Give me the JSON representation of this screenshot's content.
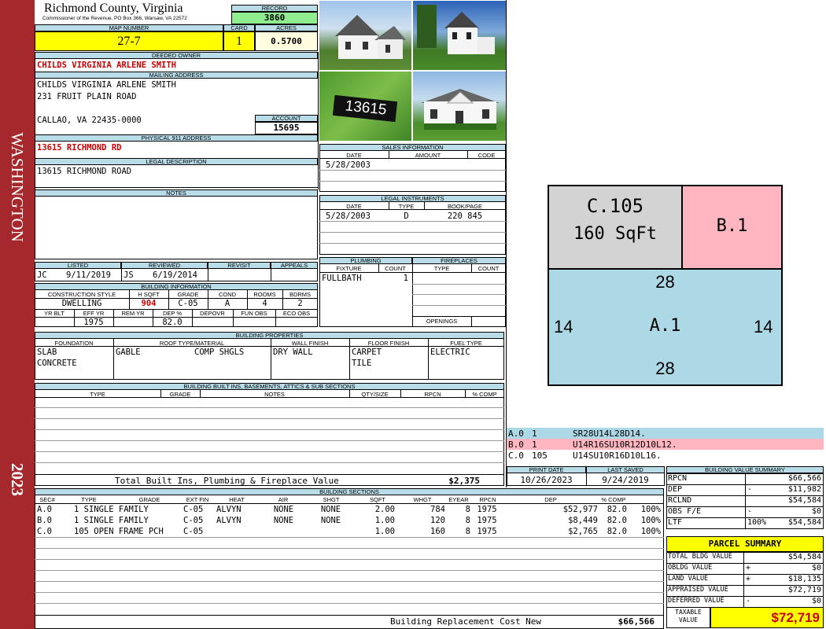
{
  "spine": {
    "district": "WASHINGTON",
    "year": "2023"
  },
  "header": {
    "county": "Richmond County, Virginia",
    "commissioner": "Commissioner of the Revenue, PO Box 366, Warsaw, VA 22572"
  },
  "record": {
    "label": "RECORD",
    "value": "3860"
  },
  "map": {
    "label": "MAP NUMBER",
    "value": "27-7"
  },
  "card": {
    "label": "CARD",
    "value": "1"
  },
  "acres": {
    "label": "ACRES",
    "value": "0.5700"
  },
  "owner": {
    "label": "DEEDED OWNER",
    "value": "CHILDS VIRGINIA ARLENE SMITH"
  },
  "mailing": {
    "label": "MAILING ADDRESS",
    "line1": "CHILDS VIRGINIA ARLENE SMITH",
    "line2": "231 FRUIT PLAIN ROAD",
    "line3": "CALLAO, VA 22435-0000"
  },
  "account": {
    "label": "ACCOUNT",
    "value": "15695"
  },
  "physical": {
    "label": "PHYSICAL 911 ADDRESS",
    "value": "13615 RICHMOND RD"
  },
  "legal": {
    "label": "LEGAL DESCRIPTION",
    "value": "13615 RICHMOND ROAD"
  },
  "notes": {
    "label": "NOTES"
  },
  "photos": {
    "sign_text": "13615"
  },
  "sales": {
    "label": "SALES INFORMATION",
    "cols": [
      "DATE",
      "AMOUNT",
      "CODE"
    ],
    "rows": [
      [
        "5/28/2003",
        "",
        ""
      ]
    ]
  },
  "legal_inst": {
    "label": "LEGAL INSTRUMENTS",
    "cols": [
      "DATE",
      "TYPE",
      "BOOK/PAGE"
    ],
    "rows": [
      [
        "5/28/2003",
        "D",
        "220 845"
      ]
    ]
  },
  "listed": {
    "listed_label": "LISTED",
    "reviewed_label": "REVIEWED",
    "revisit_label": "REVISIT",
    "appeals_label": "APPEALS",
    "listed_by": "JC",
    "listed_date": "9/11/2019",
    "reviewed_by": "JS",
    "reviewed_date": "6/19/2014"
  },
  "plumbing": {
    "label": "PLUMBING",
    "fixture": "FIXTURE",
    "count": "COUNT",
    "row_fixture": "FULLBATH",
    "row_count": "1"
  },
  "fireplaces": {
    "label": "FIREPLACES",
    "type": "TYPE",
    "count": "COUNT",
    "openings": "OPENINGS"
  },
  "bldg_info": {
    "label": "BUILDING INFORMATION",
    "cols": [
      "CONSTRUCTION STYLE",
      "H SQFT",
      "GRADE",
      "COND",
      "ROOMS",
      "BDRMS"
    ],
    "vals": [
      "DWELLING",
      "904",
      "C-05",
      "A",
      "4",
      "2"
    ],
    "cols2": [
      "YR BLT",
      "EFF YR",
      "REM YR",
      "DEP %",
      "DEPOVR",
      "FUN OBS",
      "ECO OBS"
    ],
    "vals2": [
      "",
      "1975",
      "",
      "82.0",
      "",
      "",
      ""
    ]
  },
  "props": {
    "label": "BUILDING PROPERTIES",
    "cols": [
      "FOUNDATION",
      "ROOF TYPE/MATERIAL",
      "WALL FINISH",
      "FLOOR FINISH",
      "FUEL TYPE"
    ],
    "foundation1": "SLAB",
    "foundation2": "CONCRETE",
    "roof_type": "GABLE",
    "roof_mat": "COMP SHGLS",
    "wall": "DRY WALL",
    "floor1": "CARPET",
    "floor2": "TILE",
    "fuel": "ELECTRIC"
  },
  "builtins": {
    "label": "BUILDING BUILT INS, BASEMENTS, ATTICS & SUB SECTIONS",
    "cols": [
      "TYPE",
      "GRADE",
      "NOTES",
      "QTY/SIZE",
      "RPCN",
      "% COMP"
    ],
    "total_label": "Total Built Ins, Plumbing & Fireplace Value",
    "total_value": "$2,375"
  },
  "sections": {
    "label": "BUILDING SECTIONS",
    "cols": [
      "SEC#",
      "TYPE",
      "GRADE",
      "EXT FIN",
      "HEAT",
      "AIR",
      "SHGT",
      "SQFT",
      "WHGT",
      "EYEAR",
      "RPCN",
      "DEP",
      "% COMP"
    ],
    "rows": [
      [
        "A.0",
        "1 SINGLE FAMILY",
        "C-05",
        "ALVYN",
        "NONE",
        "NONE",
        "2.00",
        "784",
        "8",
        "1975",
        "$52,977",
        "82.0",
        "100%"
      ],
      [
        "B.0",
        "1 SINGLE FAMILY",
        "C-05",
        "ALVYN",
        "NONE",
        "NONE",
        "1.00",
        "120",
        "8",
        "1975",
        "$8,449",
        "82.0",
        "100%"
      ],
      [
        "C.0",
        "105 OPEN FRAME PCH",
        "C-05",
        "",
        "",
        "",
        "1.00",
        "160",
        "8",
        "1975",
        "$2,765",
        "82.0",
        "100%"
      ]
    ],
    "replacement_label": "Building Replacement Cost New",
    "replacement_value": "$66,566"
  },
  "sketch": {
    "c_label": "C.105",
    "c_area": "160 SqFt",
    "b_label": "B.1",
    "a_label": "A.1",
    "dim_top": "28",
    "dim_bottom": "28",
    "dim_left": "14",
    "dim_right": "14",
    "color_a": "#add8e6",
    "color_b": "#ffb6c1",
    "color_c": "#d3d3d3"
  },
  "vectors": [
    {
      "sec": "A.0",
      "n": "1",
      "code": "SR28U14L28D14."
    },
    {
      "sec": "B.0",
      "n": "1",
      "code": "U14R16SU10R12D10L12."
    },
    {
      "sec": "C.0",
      "n": "105",
      "code": "U14SU10R16D10L16."
    }
  ],
  "dates": {
    "print_label": "PRINT DATE",
    "saved_label": "LAST SAVED",
    "print": "10/26/2023",
    "saved": "9/24/2019"
  },
  "bvs": {
    "label": "BUILDING VALUE SUMMARY",
    "rows": [
      {
        "k": "RPCN",
        "s": "",
        "v": "$66,566"
      },
      {
        "k": "DEP",
        "s": "-",
        "v": "$11,982"
      },
      {
        "k": "RCLND",
        "s": "",
        "v": "$54,584"
      },
      {
        "k": "OBS F/E",
        "s": "-",
        "v": "$0"
      },
      {
        "k": "LTF",
        "s": "100%",
        "v": "$54,584"
      }
    ]
  },
  "parcel": {
    "label": "PARCEL SUMMARY",
    "rows": [
      {
        "k": "TOTAL BLDG VALUE",
        "s": "",
        "v": "$54,584"
      },
      {
        "k": "OBLDG VALUE",
        "s": "+",
        "v": "$0"
      },
      {
        "k": "LAND VALUE",
        "s": "+",
        "v": "$18,135"
      },
      {
        "k": "APPRAISED VALUE",
        "s": "",
        "v": "$72,719"
      },
      {
        "k": "DEFERRED VALUE",
        "s": "-",
        "v": "$0"
      }
    ],
    "taxable_label1": "TAXABLE",
    "taxable_label2": "VALUE",
    "taxable_value": "$72,719"
  }
}
